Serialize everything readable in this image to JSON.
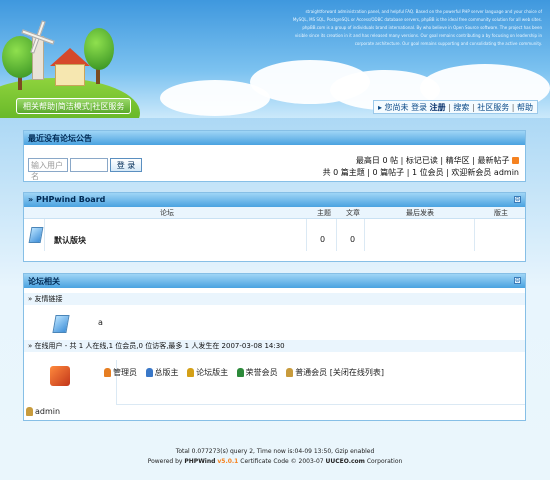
{
  "header": {
    "intro_text": "straightforward administration panel, and helpful FAQ. Based on the powerful PHP server language and your choice of MySQL, MS SQL, PostgreSQL or Access/ODBC database servers, phpBB is the ideal free community solution for all web sites. phpBB.com is a group of individuals brand international. By who believe in Open Source software. The project has been visible since its creation in it and has released many versions. Our goal remains contributing a by focusing on leadership in corporate architecture. Our goal remains supporting and consolidating the active community."
  },
  "topnav": {
    "items": [
      "相关帮助",
      "简洁模式",
      "社区服务"
    ],
    "separator": "|"
  },
  "usernav": {
    "items": [
      "您尚未",
      "登录",
      "注册",
      "搜索",
      "社区服务",
      "帮助"
    ],
    "bold_item": "注册",
    "separator": "|"
  },
  "announce": {
    "title": "最近没有论坛公告",
    "username_placeholder": "输入用户名",
    "login_button": "登 录",
    "right_line1": "最高日 0 帖 | 标记已读 | 精华区 | 最新帖子",
    "right_line2": "共 0 篇主题 | 0 篇帖子 | 1 位会员 | 欢迎新会员 admin"
  },
  "board": {
    "title": "» PHPwind Board",
    "collapse": "⊖",
    "columns": [
      "论坛",
      "主题",
      "文章",
      "最后发表",
      "版主"
    ],
    "rows": [
      {
        "name": "默认版块",
        "topics": "0",
        "posts": "0",
        "last": "",
        "mods": ""
      }
    ]
  },
  "related": {
    "title": "论坛相关",
    "collapse": "⊖",
    "links_label": "» 友情链接",
    "links_value": "a",
    "online_label": "» 在线用户 - 共 1 人在线,1 位会员,0 位访客,最多 1 人发生在 2007-03-08 14:30",
    "legend": [
      {
        "label": "管理员",
        "color": "#e67e22"
      },
      {
        "label": "总版主",
        "color": "#3a78c8"
      },
      {
        "label": "论坛版主",
        "color": "#d4a017"
      },
      {
        "label": "荣誉会员",
        "color": "#2c8a3a"
      },
      {
        "label": "普通会员",
        "color": "#c89b3c"
      }
    ],
    "legend_extra": "[关闭在线列表]",
    "online_user": "admin"
  },
  "footer": {
    "line1": "Total 0.077273(s) query 2, Time now is:04-09 13:50, Gzip enabled",
    "line2_prefix": "Powered by ",
    "brand": "PHPWind",
    "version": "v5.0.1",
    "line2_rest": " Certificate Code © 2003-07 ",
    "company": "UUCEO.com",
    "suffix": " Corporation"
  },
  "colors": {
    "accent": "#4aa2e0",
    "nav_green": "#5aa92b",
    "link": "#0a4a88"
  }
}
